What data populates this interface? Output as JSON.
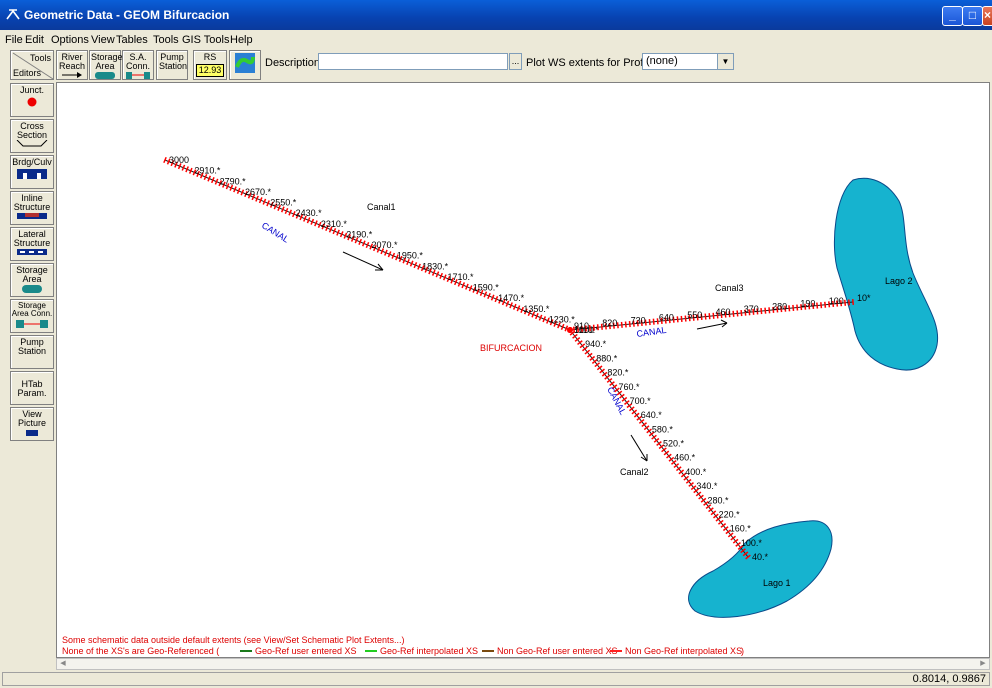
{
  "window": {
    "title": "Geometric Data - GEOM Bifurcacion"
  },
  "menu": [
    "File",
    "Edit",
    "Options",
    "View",
    "Tables",
    "Tools",
    "GIS Tools",
    "Help"
  ],
  "toolbar": {
    "tools_label": "Tools",
    "editors_label": "Editors",
    "river_reach": "River Reach",
    "storage_area": "Storage Area",
    "sa_conn": "S.A. Conn.",
    "pump_station": "Pump Station",
    "rs_label": "RS",
    "rs_value": "12.93",
    "description_label": "Description :",
    "description_value": "",
    "desc_btn": "...",
    "plot_ws_label": "Plot WS extents for Profile:",
    "profile_value": "(none)"
  },
  "editors": [
    "Junct.",
    "Cross Section",
    "Brdg/Culv",
    "Inline Structure",
    "Lateral Structure",
    "Storage Area",
    "Storage Area Conn.",
    "Pump Station",
    "HTab Param.",
    "View Picture"
  ],
  "schematic": {
    "reaches": {
      "canal1": "Canal1",
      "canal2": "Canal2",
      "canal3": "Canal3",
      "river": "CANAL"
    },
    "junction": "BIFURCACION",
    "lakes": [
      "Lago 1",
      "Lago 2"
    ],
    "canal1_xs": [
      "3000",
      "2910.*",
      "2790.*",
      "2670.*",
      "2550.*",
      "2430.*",
      "2310.*",
      "2190.*",
      "2070.*",
      "1950.*",
      "1830.*",
      "1710.*",
      "1590.*",
      "1470.*",
      "1350.*",
      "1230.*",
      "1110.*"
    ],
    "canal2_xs": [
      "1000",
      "940.*",
      "880.*",
      "820.*",
      "760.*",
      "700.*",
      "640.*",
      "580.*",
      "520.*",
      "460.*",
      "400.*",
      "340.*",
      "280.*",
      "220.*",
      "160.*",
      "100.*",
      "40.*"
    ],
    "canal3_xs": [
      "910",
      "820",
      "730",
      "640",
      "550",
      "460",
      "370",
      "280",
      "190",
      "100",
      "10*"
    ],
    "warning": "Some schematic data outside default extents (see View/Set Schematic Plot Extents...)",
    "legend_prefix": "None of the XS's are Geo-Referenced (",
    "legend_items": [
      {
        "label": "Geo-Ref user entered XS",
        "color": "#1b7a1b"
      },
      {
        "label": "Geo-Ref interpolated XS",
        "color": "#22cc22"
      },
      {
        "label": "Non Geo-Ref user entered XS",
        "color": "#7a4a10"
      },
      {
        "label": "Non Geo-Ref interpolated XS",
        "color": "#ff2020"
      }
    ],
    "legend_suffix": ")",
    "colors": {
      "lake": "#16b3cf",
      "xs": "#ff0000",
      "reach": "#1a1a1a",
      "river_label": "#0000cc",
      "warning": "#dd0000"
    }
  },
  "status": {
    "coords": "0.8014, 0.9867"
  }
}
